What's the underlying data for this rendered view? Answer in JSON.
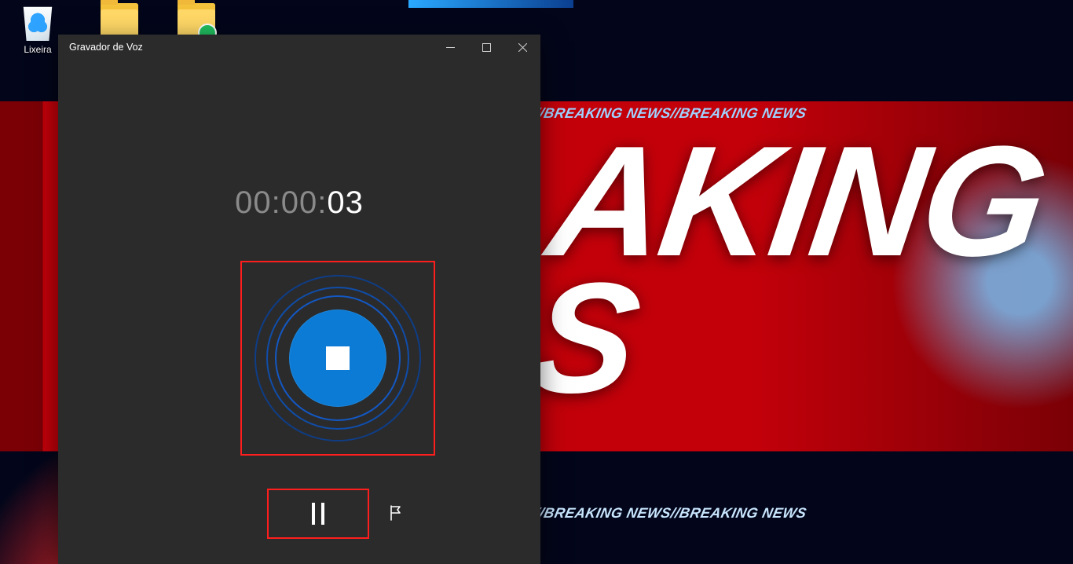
{
  "desktop": {
    "icons": [
      {
        "label": "Lixeira"
      }
    ],
    "wallpaper": {
      "headline_row1": "AKING",
      "headline_row2": "S",
      "stripe_text": "BREAKING NEWS//BREAKING NEWS//BREAKING NEWS"
    }
  },
  "window": {
    "title": "Gravador de Voz",
    "timer": {
      "dim": "00:00:",
      "seconds": "03"
    }
  }
}
